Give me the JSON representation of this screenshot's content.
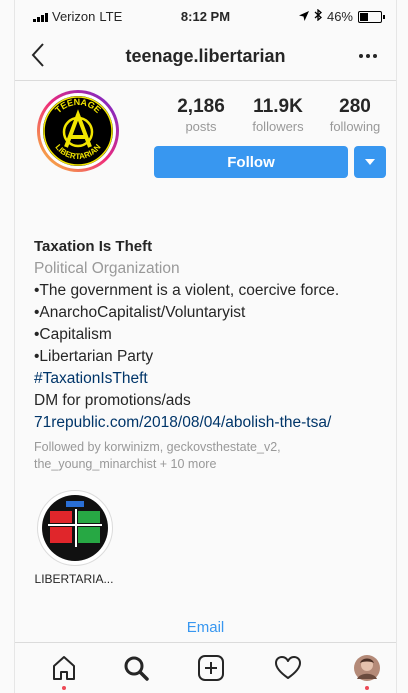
{
  "status": {
    "carrier": "Verizon",
    "network": "LTE",
    "time": "8:12 PM",
    "battery": "46%",
    "battery_level": 0.46
  },
  "nav": {
    "title": "teenage.libertarian",
    "back_icon": "chevron-left-icon",
    "more_icon": "more-horizontal-icon"
  },
  "avatar": {
    "text_top": "TEENAGE",
    "text_bottom": "LIBERTARIAN"
  },
  "stats": [
    {
      "value": "2,186",
      "label": "posts"
    },
    {
      "value": "11.9K",
      "label": "followers"
    },
    {
      "value": "280",
      "label": "following"
    }
  ],
  "follow": {
    "label": "Follow",
    "color": "#3897f0"
  },
  "bio": {
    "name": "Taxation Is Theft",
    "category": "Political Organization",
    "lines": [
      "•The government is a violent, coercive force.",
      "•AnarchoCapitalist/Voluntaryist",
      "•Capitalism",
      "•Libertarian Party"
    ],
    "hashtag": "#TaxationIsTheft",
    "dm": "DM for promotions/ads",
    "link": "71republic.com/2018/08/04/abolish-the-tsa/",
    "followed_by": "Followed by korwinizm, geckovsthestate_v2, the_young_minarchist + 10 more"
  },
  "highlight": {
    "label": "LIBERTARIA..."
  },
  "email": {
    "label": "Email"
  },
  "tabbar": {
    "icons": [
      "home-icon",
      "search-icon",
      "add-icon",
      "heart-icon",
      "profile-avatar"
    ]
  }
}
